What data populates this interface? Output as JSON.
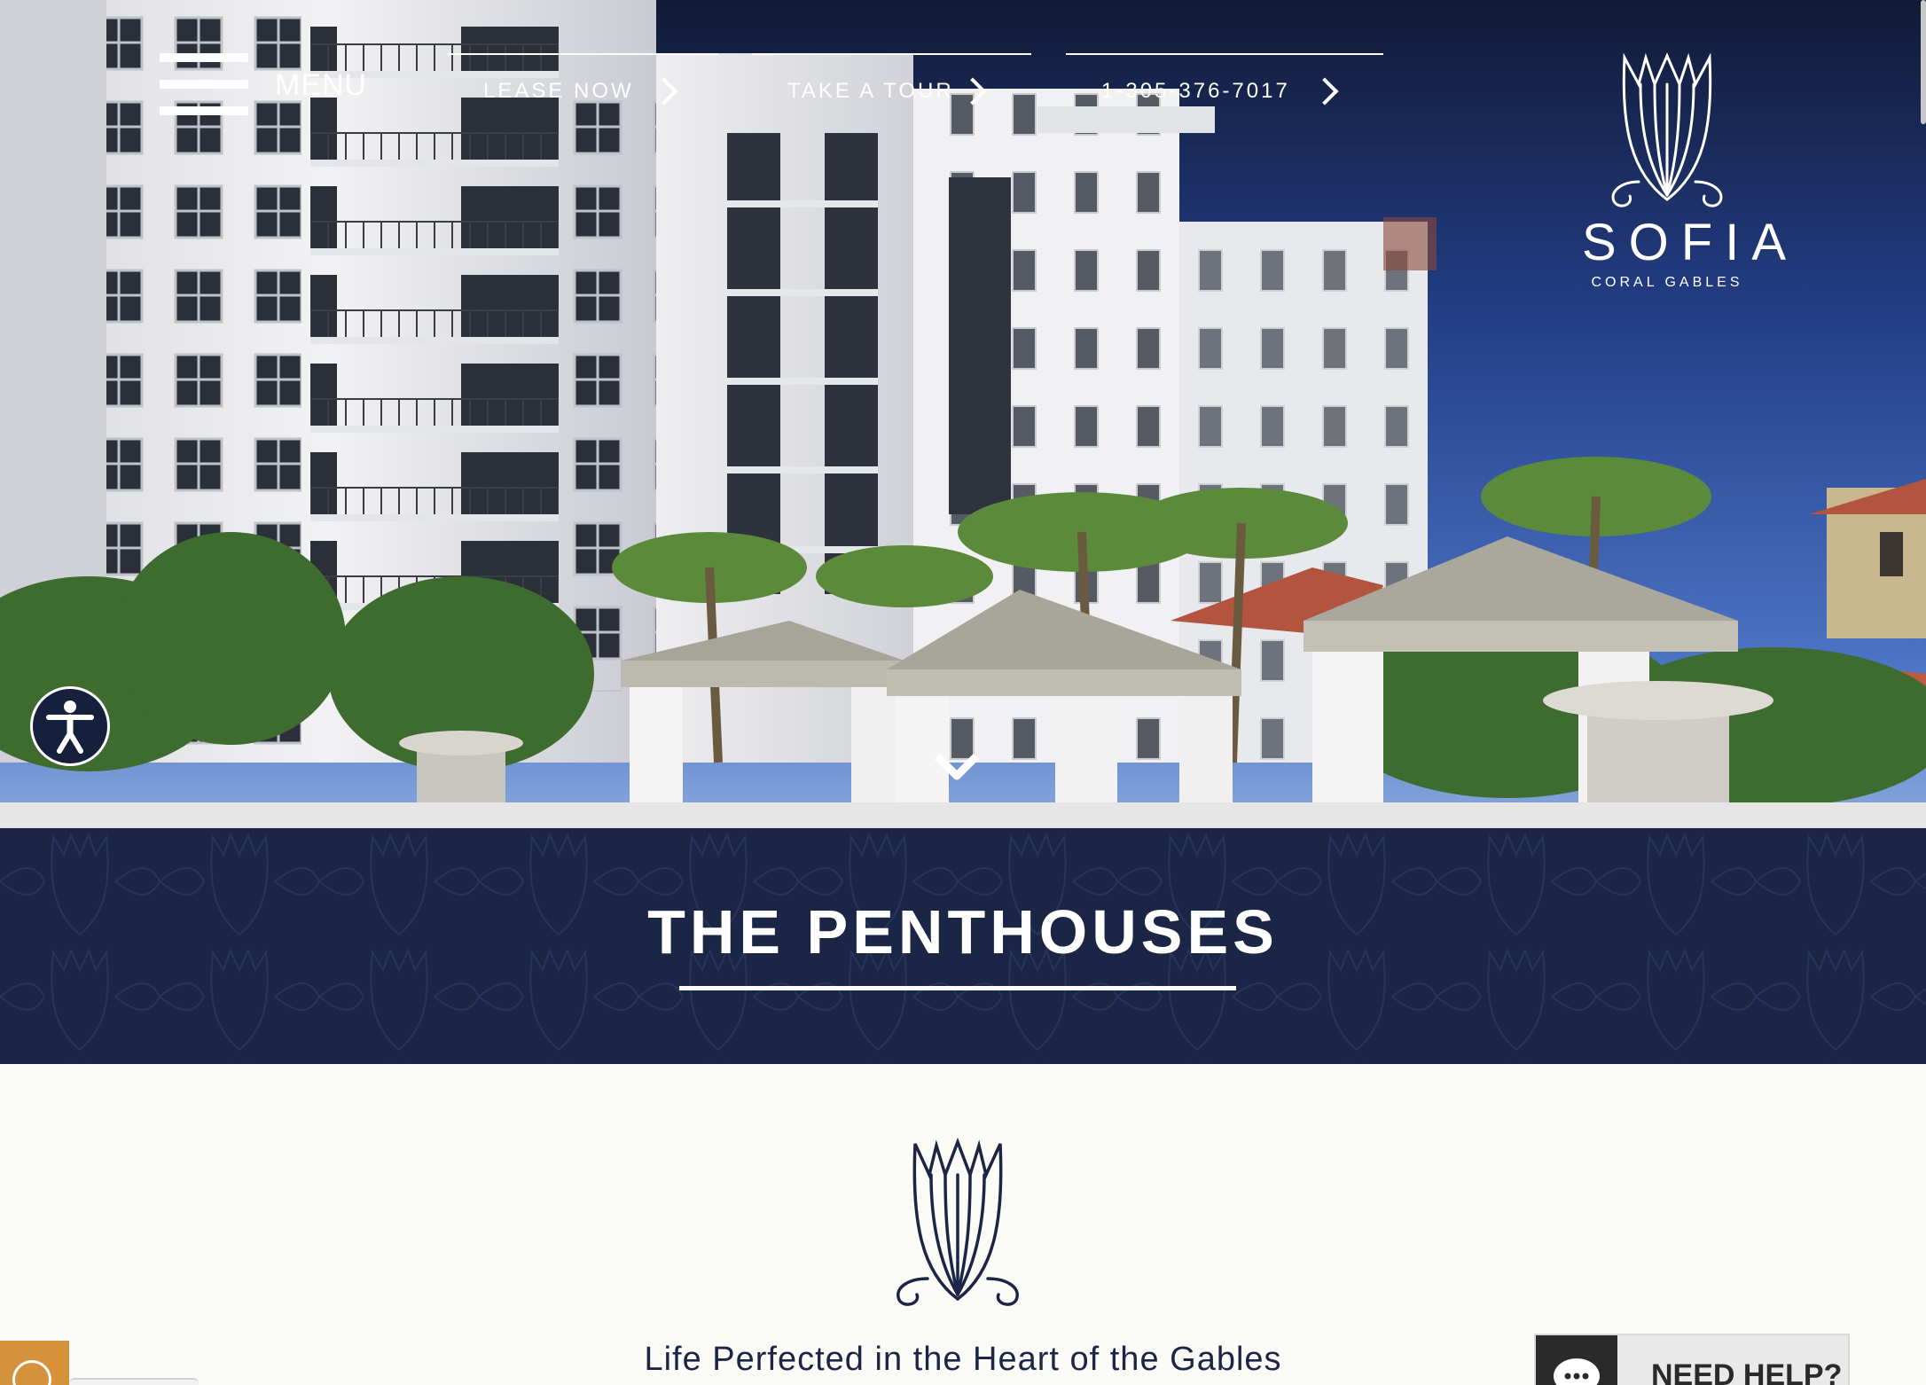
{
  "nav": {
    "menu_label": "MENU",
    "links": [
      {
        "label": "LEASE NOW"
      },
      {
        "label": "TAKE A TOUR"
      },
      {
        "label": "1-305-376-7017"
      }
    ]
  },
  "brand": {
    "name": "SOFIA",
    "subtitle": "CORAL GABLES"
  },
  "hero": {
    "scroll_icon": "chevron-down-icon",
    "accessibility_icon": "accessibility-icon"
  },
  "banner": {
    "title": "THE PENTHOUSES"
  },
  "content": {
    "tagline": "Life Perfected in the Heart of the Gables"
  },
  "widgets": {
    "help_label": "NEED HELP?",
    "help_icon": "chat-bubble-icon",
    "info_icon": "info-icon"
  },
  "colors": {
    "navy": "#1b2647",
    "accent_orange": "#d6923a",
    "background": "#fbfbf8"
  }
}
